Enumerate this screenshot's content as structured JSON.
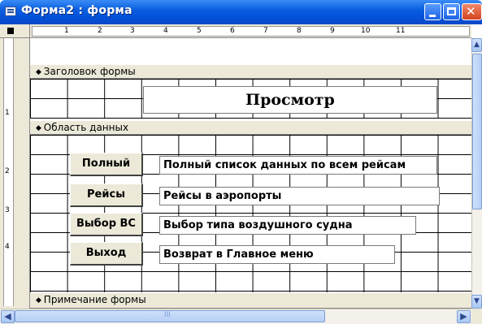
{
  "window": {
    "title": "Форма2 : форма"
  },
  "ruler": {
    "horizontal_numbers": [
      "1",
      "2",
      "3",
      "4",
      "5",
      "6",
      "7",
      "8",
      "9",
      "10",
      "11"
    ],
    "vertical_numbers": [
      "1",
      "2",
      "3",
      "4"
    ]
  },
  "sections": {
    "header": "Заголовок формы",
    "detail": "Область данных",
    "footer": "Примечание формы"
  },
  "header_section": {
    "title_label": "Просмотр"
  },
  "detail_section": {
    "rows": [
      {
        "button": "Полный",
        "description": "Полный список данных по всем рейсам"
      },
      {
        "button": "Рейсы",
        "description": "Рейсы в аэропорты"
      },
      {
        "button": "Выбор ВС",
        "description": "Выбор типа воздушного судна"
      },
      {
        "button": "Выход",
        "description": "Возврат в Главное меню"
      }
    ]
  },
  "scrollbars": {
    "thumb_grip": "III"
  }
}
